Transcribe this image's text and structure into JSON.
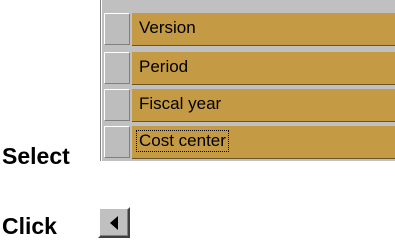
{
  "instructions": {
    "select_label": "Select",
    "click_label": "Click"
  },
  "table": {
    "rows": [
      {
        "label": "Version"
      },
      {
        "label": "Period"
      },
      {
        "label": "Fiscal year"
      },
      {
        "label": "Cost center"
      }
    ]
  },
  "icons": {
    "scroll_button": "arrow-left-icon"
  },
  "colors": {
    "cell_background": "#c49a45",
    "selector_background": "#bdbdbd"
  }
}
